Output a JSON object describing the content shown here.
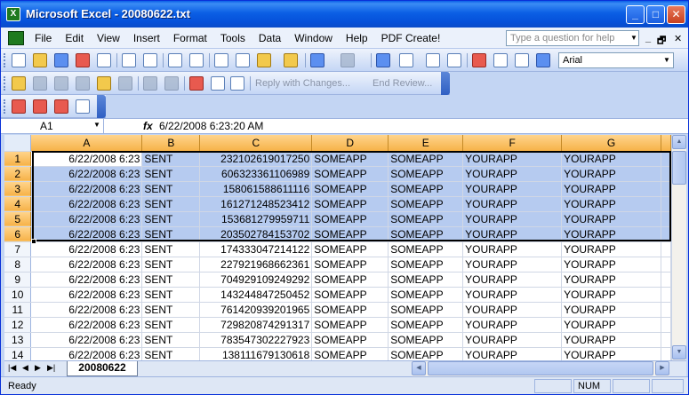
{
  "window": {
    "title": "Microsoft Excel - 20080622.txt"
  },
  "menubar": {
    "items": [
      "File",
      "Edit",
      "View",
      "Insert",
      "Format",
      "Tools",
      "Data",
      "Window",
      "Help",
      "PDF Create!"
    ],
    "help_placeholder": "Type a question for help"
  },
  "toolbar": {
    "font_name": "Arial",
    "reply_with_changes": "Reply with Changes...",
    "end_review": "End Review..."
  },
  "formula_bar": {
    "name_box": "A1",
    "fx": "fx",
    "value": "6/22/2008  6:23:20 AM"
  },
  "grid": {
    "columns": [
      "A",
      "B",
      "C",
      "D",
      "E",
      "F",
      "G"
    ],
    "selected_rows": [
      1,
      2,
      3,
      4,
      5,
      6
    ],
    "rows": [
      {
        "n": "1",
        "a": "6/22/2008 6:23",
        "b": "SENT",
        "c": "232102619017250",
        "d": "SOMEAPP",
        "e": "SOMEAPP",
        "f": "YOURAPP",
        "g": "YOURAPP"
      },
      {
        "n": "2",
        "a": "6/22/2008 6:23",
        "b": "SENT",
        "c": "606323361106989",
        "d": "SOMEAPP",
        "e": "SOMEAPP",
        "f": "YOURAPP",
        "g": "YOURAPP"
      },
      {
        "n": "3",
        "a": "6/22/2008 6:23",
        "b": "SENT",
        "c": "158061588611116",
        "d": "SOMEAPP",
        "e": "SOMEAPP",
        "f": "YOURAPP",
        "g": "YOURAPP"
      },
      {
        "n": "4",
        "a": "6/22/2008 6:23",
        "b": "SENT",
        "c": "161271248523412",
        "d": "SOMEAPP",
        "e": "SOMEAPP",
        "f": "YOURAPP",
        "g": "YOURAPP"
      },
      {
        "n": "5",
        "a": "6/22/2008 6:23",
        "b": "SENT",
        "c": "153681279959711",
        "d": "SOMEAPP",
        "e": "SOMEAPP",
        "f": "YOURAPP",
        "g": "YOURAPP"
      },
      {
        "n": "6",
        "a": "6/22/2008 6:23",
        "b": "SENT",
        "c": "203502784153702",
        "d": "SOMEAPP",
        "e": "SOMEAPP",
        "f": "YOURAPP",
        "g": "YOURAPP"
      },
      {
        "n": "7",
        "a": "6/22/2008 6:23",
        "b": "SENT",
        "c": "174333047214122",
        "d": "SOMEAPP",
        "e": "SOMEAPP",
        "f": "YOURAPP",
        "g": "YOURAPP"
      },
      {
        "n": "8",
        "a": "6/22/2008 6:23",
        "b": "SENT",
        "c": "227921968662361",
        "d": "SOMEAPP",
        "e": "SOMEAPP",
        "f": "YOURAPP",
        "g": "YOURAPP"
      },
      {
        "n": "9",
        "a": "6/22/2008 6:23",
        "b": "SENT",
        "c": "704929109249292",
        "d": "SOMEAPP",
        "e": "SOMEAPP",
        "f": "YOURAPP",
        "g": "YOURAPP"
      },
      {
        "n": "10",
        "a": "6/22/2008 6:23",
        "b": "SENT",
        "c": "143244847250452",
        "d": "SOMEAPP",
        "e": "SOMEAPP",
        "f": "YOURAPP",
        "g": "YOURAPP"
      },
      {
        "n": "11",
        "a": "6/22/2008 6:23",
        "b": "SENT",
        "c": "761420939201965",
        "d": "SOMEAPP",
        "e": "SOMEAPP",
        "f": "YOURAPP",
        "g": "YOURAPP"
      },
      {
        "n": "12",
        "a": "6/22/2008 6:23",
        "b": "SENT",
        "c": "729820874291317",
        "d": "SOMEAPP",
        "e": "SOMEAPP",
        "f": "YOURAPP",
        "g": "YOURAPP"
      },
      {
        "n": "13",
        "a": "6/22/2008 6:23",
        "b": "SENT",
        "c": "783547302227923",
        "d": "SOMEAPP",
        "e": "SOMEAPP",
        "f": "YOURAPP",
        "g": "YOURAPP"
      },
      {
        "n": "14",
        "a": "6/22/2008 6:23",
        "b": "SENT",
        "c": "138111679130618",
        "d": "SOMEAPP",
        "e": "SOMEAPP",
        "f": "YOURAPP",
        "g": "YOURAPP"
      }
    ]
  },
  "sheet_tabs": {
    "active": "20080622"
  },
  "statusbar": {
    "text": "Ready",
    "num": "NUM"
  },
  "colors": {
    "title_blue": "#0a5fe6",
    "header_orange": "#f6b248",
    "selection_blue": "#b6cbf0"
  }
}
